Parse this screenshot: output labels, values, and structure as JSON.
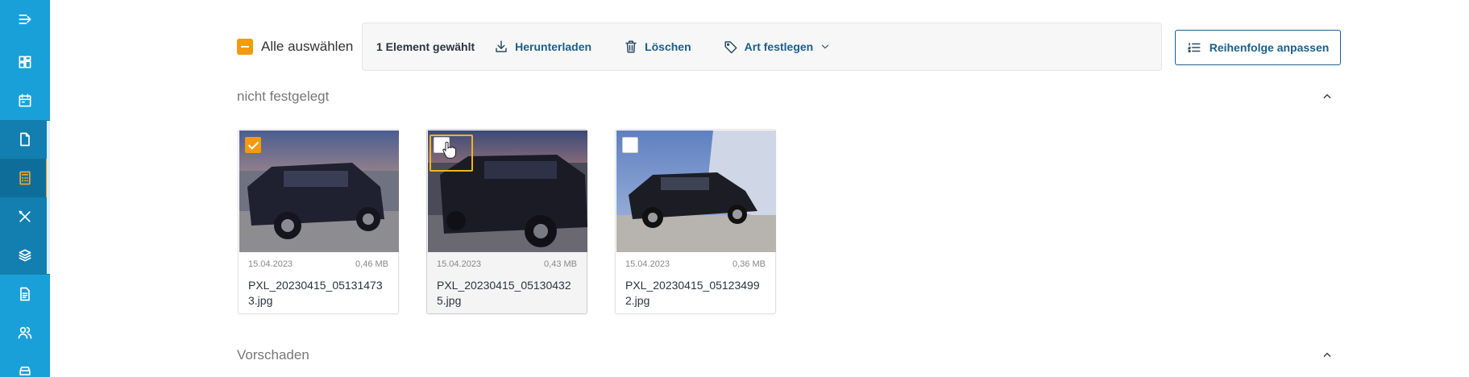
{
  "sidebar": {
    "items": [
      {
        "icon": "menu-collapse-icon"
      },
      {
        "icon": "dashboard-icon"
      },
      {
        "icon": "calendar-icon"
      },
      {
        "icon": "document-icon"
      },
      {
        "icon": "calculator-icon"
      },
      {
        "icon": "tools-icon"
      },
      {
        "icon": "layers-icon"
      },
      {
        "icon": "report-icon"
      },
      {
        "icon": "users-icon"
      },
      {
        "icon": "car-icon"
      }
    ],
    "active_index": 4,
    "colors": {
      "bg": "#1aa0d8",
      "active_accent": "#f39a0d"
    }
  },
  "toolbar": {
    "select_all_label": "Alle auswählen",
    "selected_count": "1 Element gewählt",
    "download_label": "Herunterladen",
    "delete_label": "Löschen",
    "set_type_label": "Art festlegen",
    "reorder_label": "Reihenfolge anpassen"
  },
  "sections": [
    {
      "title": "nicht festgelegt",
      "expanded": true,
      "files": [
        {
          "date": "15.04.2023",
          "size": "0,46 MB",
          "name": "PXL_20230415_051314733.jpg",
          "checked": true
        },
        {
          "date": "15.04.2023",
          "size": "0,43 MB",
          "name": "PXL_20230415_051304325.jpg",
          "checked": false
        },
        {
          "date": "15.04.2023",
          "size": "0,36 MB",
          "name": "PXL_20230415_051234992.jpg",
          "checked": false
        }
      ]
    },
    {
      "title": "Vorschaden",
      "expanded": true
    }
  ],
  "colors": {
    "accent": "#f39a0d",
    "link": "#1a5f8a"
  }
}
